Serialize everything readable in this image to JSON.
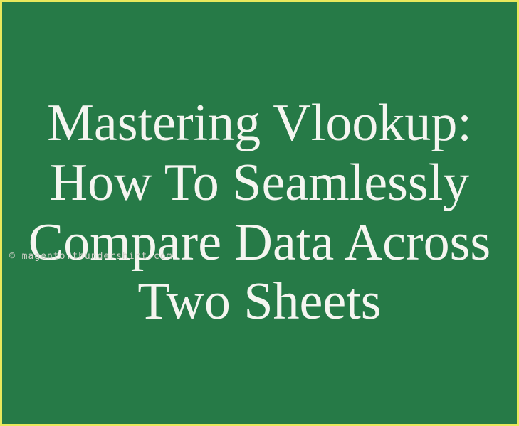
{
  "title": "Mastering Vlookup: How To Seamlessly Compare Data Across Two Sheets",
  "watermark": "© magento.thundershirt.com"
}
